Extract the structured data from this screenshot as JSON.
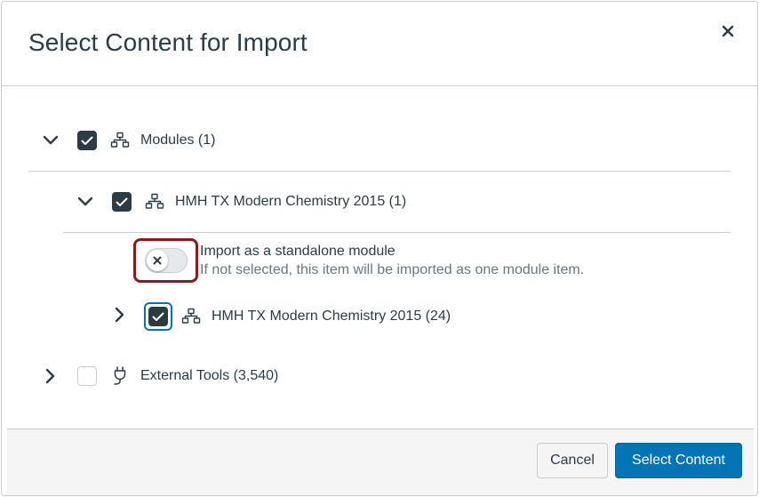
{
  "modal": {
    "title": "Select Content for Import",
    "close_icon": "close-icon"
  },
  "tree": {
    "modules": {
      "label": "Modules (1)",
      "checked": true,
      "expanded": true,
      "icon": "modules-icon"
    },
    "course": {
      "label": "HMH TX Modern Chemistry 2015 (1)",
      "checked": true,
      "expanded": true,
      "icon": "modules-icon"
    },
    "standalone_toggle": {
      "title": "Import as a standalone module",
      "description": "If not selected, this item will be imported as one module item.",
      "on": false
    },
    "sub_module": {
      "label": "HMH TX Modern Chemistry 2015 (24)",
      "checked": true,
      "expanded": false,
      "icon": "modules-icon"
    },
    "external_tools": {
      "label": "External Tools (3,540)",
      "checked": false,
      "expanded": false,
      "icon": "plug-icon"
    }
  },
  "footer": {
    "cancel_label": "Cancel",
    "submit_label": "Select Content"
  },
  "colors": {
    "primary": "#0374b5",
    "text": "#2d3b45",
    "focus": "#8b1a1a"
  }
}
